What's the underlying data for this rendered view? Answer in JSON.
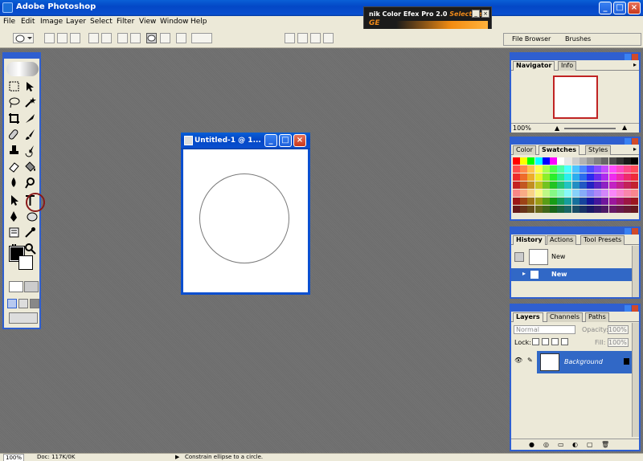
{
  "app": {
    "title": "Adobe Photoshop"
  },
  "menu": [
    "File",
    "Edit",
    "Image",
    "Layer",
    "Select",
    "Filter",
    "View",
    "Window",
    "Help"
  ],
  "banner": {
    "name": "nik Color Efex Pro 2.0",
    "edition": "Selective",
    "sub": "GE"
  },
  "palette_well": {
    "tabs": [
      "File Browser",
      "Brushes"
    ]
  },
  "toolbox": {
    "tools": [
      "marquee-tool-icon",
      "move-tool-icon",
      "lasso-tool-icon",
      "magic-wand-tool-icon",
      "crop-tool-icon",
      "slice-tool-icon",
      "healing-brush-tool-icon",
      "brush-tool-icon",
      "clone-stamp-tool-icon",
      "history-brush-tool-icon",
      "eraser-tool-icon",
      "paint-bucket-tool-icon",
      "blur-tool-icon",
      "dodge-tool-icon",
      "path-selection-tool-icon",
      "type-tool-icon",
      "pen-tool-icon",
      "ellipse-shape-tool-icon",
      "notes-tool-icon",
      "eyedropper-tool-icon",
      "hand-tool-icon",
      "zoom-tool-icon"
    ],
    "active_tool": "ellipse-shape-tool-icon",
    "foreground_color": "#000000",
    "background_color": "#ffffff"
  },
  "document": {
    "title": "Untitled-1 @ 1..."
  },
  "navigator": {
    "tabs": [
      "Navigator",
      "Info"
    ],
    "zoom": "100%"
  },
  "swatches": {
    "tabs": [
      "Color",
      "Swatches",
      "Styles"
    ]
  },
  "history": {
    "tabs": [
      "History",
      "Actions",
      "Tool Presets"
    ],
    "snapshot_label": "New",
    "items": [
      {
        "label": "New",
        "selected": true
      }
    ]
  },
  "layers": {
    "tabs": [
      "Layers",
      "Channels",
      "Paths"
    ],
    "blend_mode": "Normal",
    "opacity_label": "Opacity:",
    "opacity": "100%",
    "lock_label": "Lock:",
    "fill_label": "Fill:",
    "fill": "100%",
    "items": [
      {
        "name": "Background",
        "locked": true
      }
    ]
  },
  "status": {
    "zoom": "100%",
    "doc": "Doc: 117K/0K",
    "hint": "Constrain ellipse to a circle."
  },
  "accent_colors": {
    "window_blue": "#0a4fd0",
    "selection_blue": "#3168c6",
    "highlight_ring": "#8a1a1a"
  }
}
